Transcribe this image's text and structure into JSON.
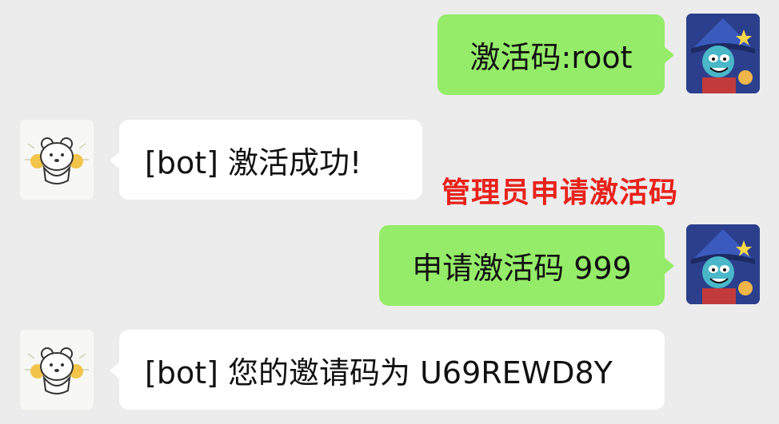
{
  "messages": [
    {
      "sender": "user",
      "text": "激活码:root",
      "avatar_icon": "wizard-avatar-icon"
    },
    {
      "sender": "bot",
      "text": "[bot] 激活成功!",
      "avatar_icon": "bear-avatar-icon"
    },
    {
      "sender": "user",
      "text": "申请激活码 999",
      "avatar_icon": "wizard-avatar-icon"
    },
    {
      "sender": "bot",
      "text": "[bot] 您的邀请码为 U69REWD8Y",
      "avatar_icon": "bear-avatar-icon"
    }
  ],
  "annotation": {
    "text": "管理员申请激活码",
    "color": "#e8211b"
  },
  "colors": {
    "background": "#ececec",
    "user_bubble": "#95ec69",
    "bot_bubble": "#ffffff",
    "user_avatar": "#2b3f8c"
  }
}
